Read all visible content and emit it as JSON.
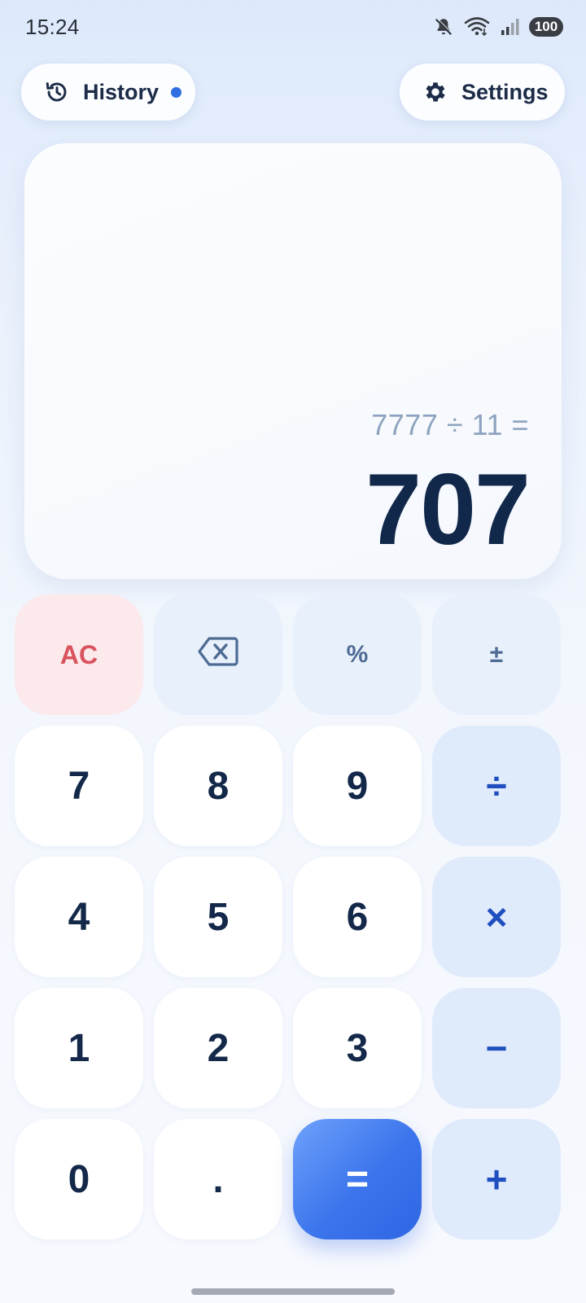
{
  "status_bar": {
    "time": "15:24",
    "battery": "100",
    "icons": [
      "mute-icon",
      "wifi-icon",
      "signal-icon"
    ]
  },
  "top_bar": {
    "history_label": "History",
    "settings_label": "Settings",
    "history_indicator_color": "#2f6fe0"
  },
  "display": {
    "expression": "7777 ÷ 11 =",
    "result": "707"
  },
  "keypad": {
    "rows": [
      [
        {
          "id": "ac",
          "label": "AC",
          "kind": "ac"
        },
        {
          "id": "backspace",
          "label": "",
          "kind": "fn",
          "icon": "backspace-icon"
        },
        {
          "id": "percent",
          "label": "%",
          "kind": "fn"
        },
        {
          "id": "plus-minus",
          "label": "±",
          "kind": "fn"
        }
      ],
      [
        {
          "id": "7",
          "label": "7",
          "kind": "digit"
        },
        {
          "id": "8",
          "label": "8",
          "kind": "digit"
        },
        {
          "id": "9",
          "label": "9",
          "kind": "digit"
        },
        {
          "id": "divide",
          "label": "÷",
          "kind": "op"
        }
      ],
      [
        {
          "id": "4",
          "label": "4",
          "kind": "digit"
        },
        {
          "id": "5",
          "label": "5",
          "kind": "digit"
        },
        {
          "id": "6",
          "label": "6",
          "kind": "digit"
        },
        {
          "id": "multiply",
          "label": "×",
          "kind": "op"
        }
      ],
      [
        {
          "id": "1",
          "label": "1",
          "kind": "digit"
        },
        {
          "id": "2",
          "label": "2",
          "kind": "digit"
        },
        {
          "id": "3",
          "label": "3",
          "kind": "digit"
        },
        {
          "id": "minus",
          "label": "−",
          "kind": "op"
        }
      ],
      [
        {
          "id": "0",
          "label": "0",
          "kind": "digit"
        },
        {
          "id": "decimal",
          "label": ".",
          "kind": "digit"
        },
        {
          "id": "equals",
          "label": "=",
          "kind": "eq"
        },
        {
          "id": "plus",
          "label": "+",
          "kind": "op"
        }
      ]
    ]
  },
  "colors": {
    "accent": "#3b74ec",
    "ac_text": "#d9535d",
    "operator_text": "#1f4fbf",
    "digit_text": "#14294a"
  }
}
